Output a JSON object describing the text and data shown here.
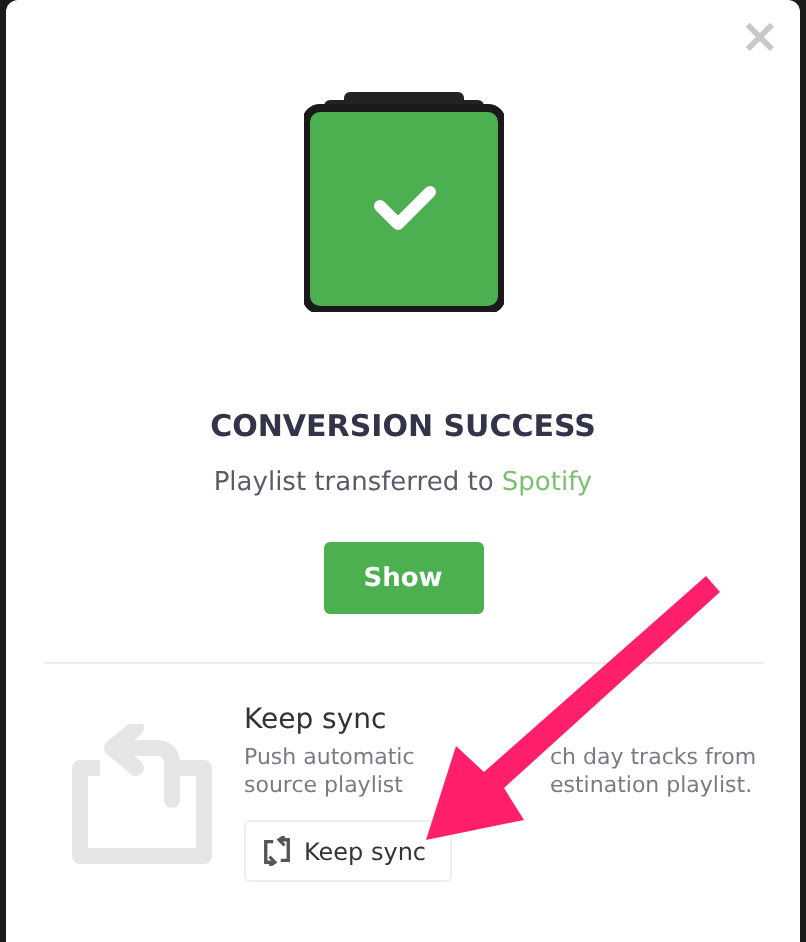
{
  "close_button": {
    "label": "×"
  },
  "status": {
    "title": "CONVERSION SUCCESS",
    "message": "Playlist transferred to",
    "service": "Spotify"
  },
  "show_button": {
    "label": "Show"
  },
  "keep_sync": {
    "title": "Keep sync",
    "description_lines": [
      [
        "Push automatic",
        "ch day tracks from"
      ],
      [
        "source playlist",
        "estination playlist."
      ]
    ],
    "button": "Keep sync"
  }
}
